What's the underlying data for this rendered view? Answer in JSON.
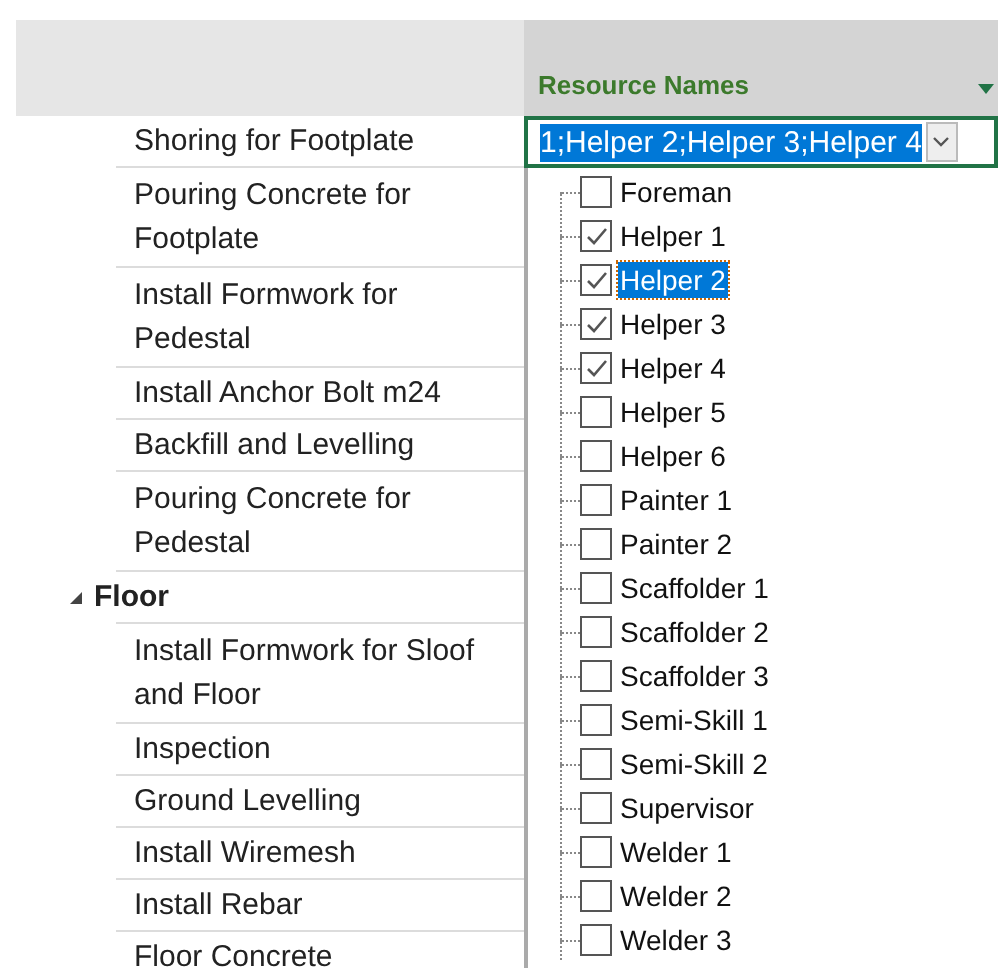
{
  "task_column": {
    "rows": [
      {
        "name": "Shoring for Footplate"
      },
      {
        "name": "Pouring Concrete for Footplate"
      },
      {
        "name": "Install Formwork for Pedestal"
      },
      {
        "name": "Install Anchor Bolt m24"
      },
      {
        "name": "Backfill and Levelling"
      },
      {
        "name": "Pouring Concrete for Pedestal"
      },
      {
        "name": "Floor",
        "expanded": true,
        "children": [
          {
            "name": "Install Formwork for Sloof and Floor"
          },
          {
            "name": "Inspection"
          },
          {
            "name": "Ground Levelling"
          },
          {
            "name": "Install Wiremesh"
          },
          {
            "name": "Install Rebar"
          },
          {
            "name": "Floor Concrete"
          }
        ]
      }
    ]
  },
  "resource_column": {
    "header": "Resource Names",
    "editor": {
      "value": "1;Helper 2;Helper 3;Helper 4"
    },
    "options": [
      {
        "label": "Foreman",
        "checked": false,
        "selected": false
      },
      {
        "label": "Helper 1",
        "checked": true,
        "selected": false
      },
      {
        "label": "Helper 2",
        "checked": true,
        "selected": true
      },
      {
        "label": "Helper 3",
        "checked": true,
        "selected": false
      },
      {
        "label": "Helper 4",
        "checked": true,
        "selected": false
      },
      {
        "label": "Helper 5",
        "checked": false,
        "selected": false
      },
      {
        "label": "Helper 6",
        "checked": false,
        "selected": false
      },
      {
        "label": "Painter 1",
        "checked": false,
        "selected": false
      },
      {
        "label": "Painter 2",
        "checked": false,
        "selected": false
      },
      {
        "label": "Scaffolder 1",
        "checked": false,
        "selected": false
      },
      {
        "label": "Scaffolder 2",
        "checked": false,
        "selected": false
      },
      {
        "label": "Scaffolder 3",
        "checked": false,
        "selected": false
      },
      {
        "label": "Semi-Skill 1",
        "checked": false,
        "selected": false
      },
      {
        "label": "Semi-Skill 2",
        "checked": false,
        "selected": false
      },
      {
        "label": "Supervisor",
        "checked": false,
        "selected": false
      },
      {
        "label": "Welder 1",
        "checked": false,
        "selected": false
      },
      {
        "label": "Welder 2",
        "checked": false,
        "selected": false
      },
      {
        "label": "Welder 3",
        "checked": false,
        "selected": false
      }
    ]
  }
}
